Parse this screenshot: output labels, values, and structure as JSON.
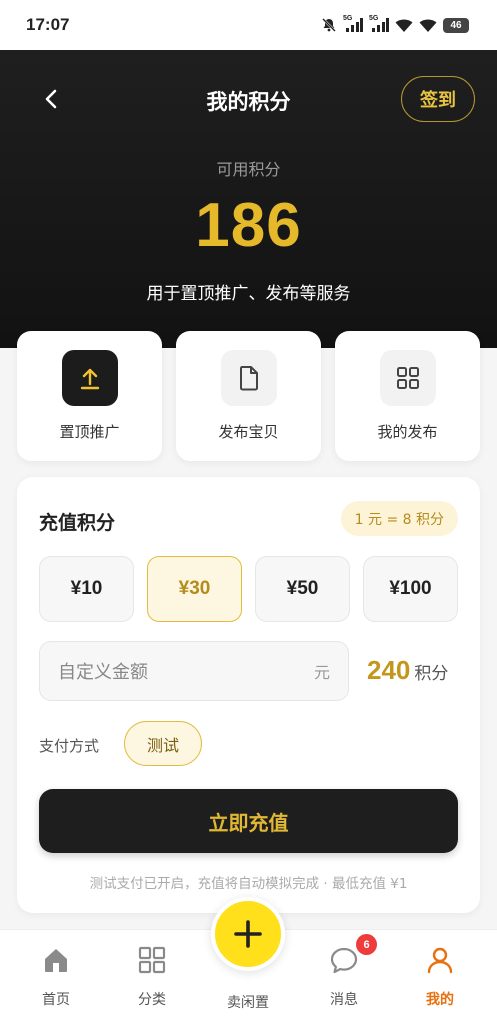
{
  "status_bar": {
    "time": "17:07",
    "signal_1_label": "5G",
    "signal_2_label": "5G",
    "battery": "46",
    "icons": [
      "mute-icon",
      "signal-icon",
      "signal-icon",
      "wifi-icon",
      "wifi-icon",
      "battery-icon"
    ]
  },
  "header": {
    "title": "我的积分",
    "checkin_label": "签到",
    "points_label": "可用积分",
    "points_value": "186",
    "points_desc": "用于置顶推广、发布等服务"
  },
  "actions": [
    {
      "label": "置顶推广",
      "icon": "upload-icon"
    },
    {
      "label": "发布宝贝",
      "icon": "document-icon"
    },
    {
      "label": "我的发布",
      "icon": "grid-icon"
    }
  ],
  "recharge": {
    "title": "充值积分",
    "rate": "1 元 = 8 积分",
    "amounts": [
      "¥10",
      "¥30",
      "¥50",
      "¥100"
    ],
    "selected_amount": "¥30",
    "custom_placeholder": "自定义金额",
    "custom_unit": "元",
    "calc_points": "240",
    "calc_points_unit": "积分",
    "pay_label": "支付方式",
    "pay_method": "测试",
    "submit_label": "立即充值",
    "note": "测试支付已开启，充值将自动模拟完成 · 最低充值 ¥1"
  },
  "bottom_nav": {
    "items": [
      {
        "label": "首页",
        "icon": "home-icon"
      },
      {
        "label": "分类",
        "icon": "category-icon"
      },
      {
        "label": "卖闲置",
        "icon": "plus-icon"
      },
      {
        "label": "消息",
        "icon": "chat-icon",
        "badge": "6"
      },
      {
        "label": "我的",
        "icon": "user-icon"
      }
    ],
    "active": "我的"
  },
  "colors": {
    "accent_gold": "#e5b92a",
    "header_bg": "#1a1a1a",
    "fab_yellow": "#ffe01a",
    "nav_active": "#e8710f",
    "badge_red": "#ee3b3b"
  }
}
